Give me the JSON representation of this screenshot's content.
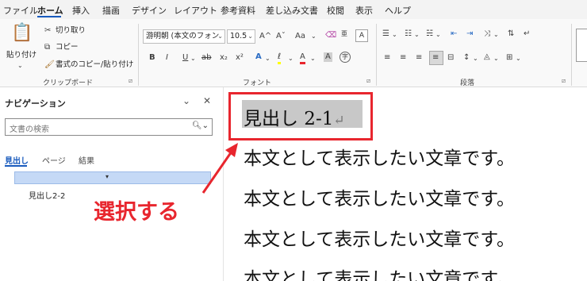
{
  "menu": {
    "tabs": [
      "ファイル",
      "ホーム",
      "挿入",
      "描画",
      "デザイン",
      "レイアウト",
      "参考資料",
      "差し込み文書",
      "校閲",
      "表示",
      "ヘルプ"
    ],
    "active_tab": "ホーム"
  },
  "ribbon": {
    "clipboard": {
      "paste": "貼り付け",
      "cut": "切り取り",
      "copy": "コピー",
      "format_painter": "書式のコピー/貼り付け",
      "label": "クリップボード"
    },
    "font": {
      "font_name": "游明朝 (本文のフォン",
      "font_size": "10.5",
      "grow": "A^",
      "shrink": "Aˇ",
      "case": "Aa",
      "clear": "A",
      "bold": "B",
      "italic": "I",
      "underline": "U",
      "strike": "ab",
      "subscript": "x₂",
      "superscript": "x²",
      "text_effects": "A",
      "highlight": "ℓ",
      "font_color": "A",
      "char_shading": "A",
      "enclose": "字",
      "label": "フォント"
    },
    "paragraph": {
      "label": "段落"
    },
    "colors": {
      "accent": "#185abd",
      "highlight_yellow": "#ffff00",
      "font_red": "#e8262e"
    }
  },
  "nav": {
    "title": "ナビゲーション",
    "search_placeholder": "文書の検索",
    "tabs": [
      "見出し",
      "ページ",
      "結果"
    ],
    "active_tab": "見出し",
    "headings": [
      "見出し2-2"
    ]
  },
  "document": {
    "heading": "見出し 2-1",
    "return_mark": "↵",
    "lines": [
      "本文として表示したい文章です。",
      "本文として表示したい文章です。",
      "本文として表示したい文章です。",
      "本文として表示したい文章です。"
    ]
  },
  "callout": {
    "text": "選択する",
    "color": "#e8262e"
  }
}
